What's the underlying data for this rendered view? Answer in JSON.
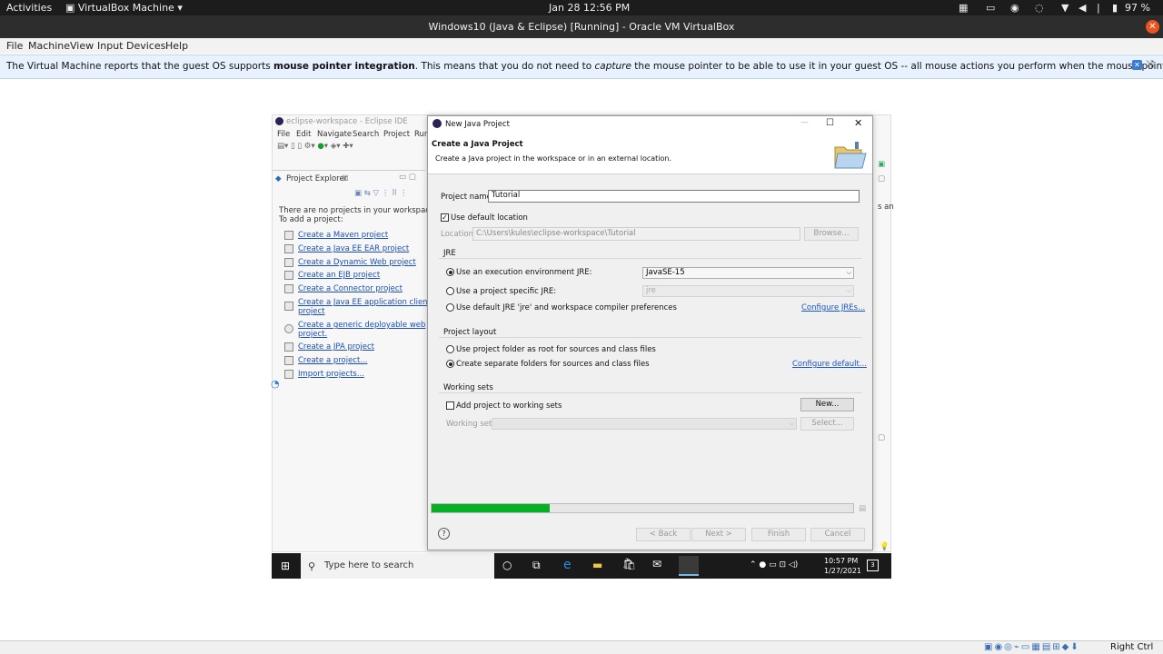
{
  "topbar": {
    "activities": "Activities",
    "app": "VirtualBox Machine",
    "clock": "Jan 28  12:56 PM",
    "battery": "97 %"
  },
  "window": {
    "title": "Windows10 (Java & Eclipse) [Running] - Oracle VM VirtualBox"
  },
  "menubar": [
    "File",
    "Machine",
    "View",
    "Input",
    "Devices",
    "Help"
  ],
  "notice": {
    "pre": "The Virtual Machine reports that the guest OS supports ",
    "bold": "mouse pointer integration",
    "mid": ". This means that you do not need to ",
    "ital": "capture",
    "post": " the mouse pointer to be able to use it in your guest OS -- all mouse actions you perform when the mouse pointer is over the Virtual Machine's display are directly sent to the"
  },
  "eclipse": {
    "title": "eclipse-workspace - Eclipse IDE",
    "menus": [
      "File",
      "Edit",
      "Navigate",
      "Search",
      "Project",
      "Run"
    ],
    "explorer_tab": "Project Explorer",
    "empty_line1": "There are no projects in your workspace.",
    "empty_line2": "To add a project:",
    "links": [
      "Create a Maven project",
      "Create a Java EE EAR project",
      "Create a Dynamic Web project",
      "Create an EJB project",
      "Create a Connector project",
      "Create a Java EE application client",
      "project",
      "Create a generic deployable web",
      "project.",
      "Create a JPA project",
      "Create a project...",
      "Import projects..."
    ],
    "right_fragment": "s an"
  },
  "dialog": {
    "title": "New Java Project",
    "heading": "Create a Java Project",
    "subheading": "Create a Java project in the workspace or in an external location.",
    "project_name_label": "Project name:",
    "project_name_value": "Tutorial",
    "use_default_location": "Use default location",
    "location_label": "Location:",
    "location_value": "C:\\Users\\kules\\eclipse-workspace\\Tutorial",
    "browse": "Browse...",
    "jre_group": "JRE",
    "jre_opt1": "Use an execution environment JRE:",
    "jre_opt1_value": "JavaSE-15",
    "jre_opt2": "Use a project specific JRE:",
    "jre_opt2_value": "jre",
    "jre_opt3": "Use default JRE 'jre' and workspace compiler preferences",
    "configure_jres": "Configure JREs...",
    "layout_group": "Project layout",
    "layout_opt1": "Use project folder as root for sources and class files",
    "layout_opt2": "Create separate folders for sources and class files",
    "configure_default": "Configure default...",
    "ws_group": "Working sets",
    "ws_add": "Add project to working sets",
    "ws_new": "New...",
    "ws_label": "Working sets:",
    "ws_select": "Select...",
    "progress": 0.28,
    "btn_back": "< Back",
    "btn_next": "Next >",
    "btn_finish": "Finish",
    "btn_cancel": "Cancel",
    "help": "?"
  },
  "win_taskbar": {
    "search_placeholder": "Type here to search",
    "time": "10:57 PM",
    "date": "1/27/2021",
    "notif": "3"
  },
  "statusbar": {
    "hostkey": "Right Ctrl"
  },
  "colors": {
    "progress": "#06b025",
    "accent": "#e95420",
    "link": "#1a56c9"
  }
}
